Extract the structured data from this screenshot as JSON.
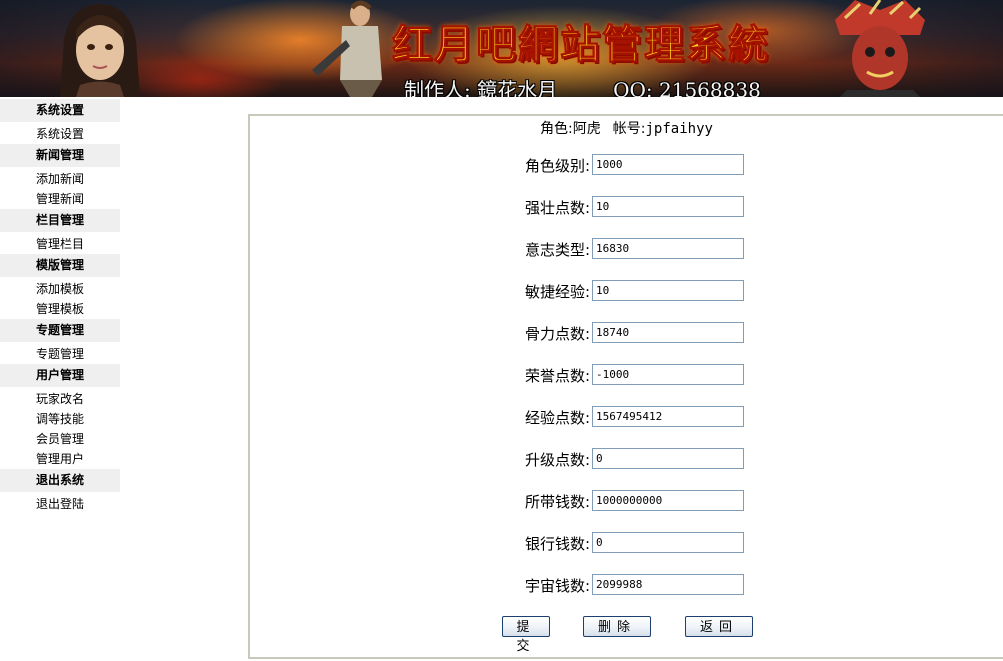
{
  "banner": {
    "title": "红月吧網站管理系統",
    "credit_author": "制作人: 鏡花水月",
    "credit_qq": "QQ: 21568838"
  },
  "sidebar": {
    "sections": [
      {
        "header": "系统设置",
        "items": [
          "系统设置"
        ]
      },
      {
        "header": "新闻管理",
        "items": [
          "添加新闻",
          "管理新闻"
        ]
      },
      {
        "header": "栏目管理",
        "items": [
          "管理栏目"
        ]
      },
      {
        "header": "模版管理",
        "items": [
          "添加模板",
          "管理模板"
        ]
      },
      {
        "header": "专题管理",
        "items": [
          "专题管理"
        ]
      },
      {
        "header": "用户管理",
        "items": [
          "玩家改名",
          "调等技能",
          "会员管理",
          "管理用户"
        ]
      },
      {
        "header": "退出系统",
        "items": [
          "退出登陆"
        ]
      }
    ]
  },
  "form": {
    "role_label": "角色:",
    "role_name": "阿虎",
    "account_label": "帐号:",
    "account_name": "jpfaihyy",
    "fields": [
      {
        "label": "角色级别:",
        "value": "1000"
      },
      {
        "label": "强壮点数:",
        "value": "10"
      },
      {
        "label": "意志类型:",
        "value": "16830"
      },
      {
        "label": "敏捷经验:",
        "value": "10"
      },
      {
        "label": "骨力点数:",
        "value": "18740"
      },
      {
        "label": "荣誉点数:",
        "value": "-1000"
      },
      {
        "label": "经验点数:",
        "value": "1567495412"
      },
      {
        "label": "升级点数:",
        "value": "0"
      },
      {
        "label": "所带钱数:",
        "value": "1000000000"
      },
      {
        "label": "银行钱数:",
        "value": "0"
      },
      {
        "label": "宇宙钱数:",
        "value": "2099988"
      }
    ],
    "buttons": {
      "submit": "提交",
      "delete": "删除",
      "back": "返回"
    }
  }
}
